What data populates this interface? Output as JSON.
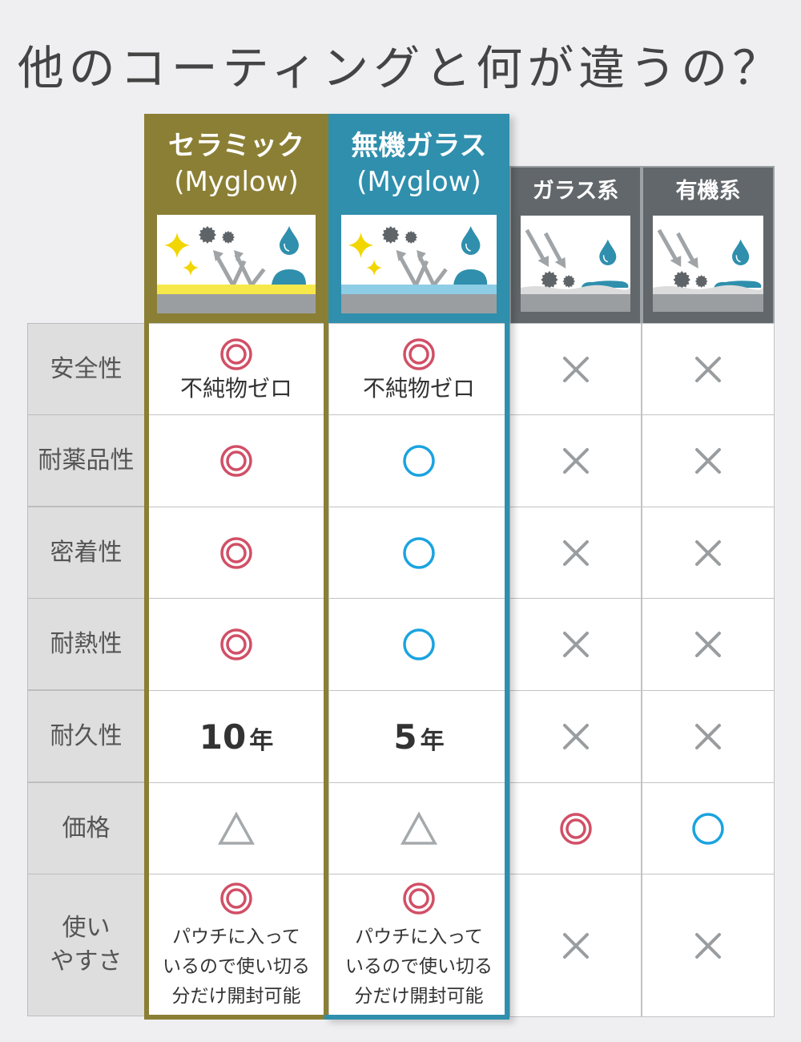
{
  "title": "他のコーティングと何が違うの？",
  "colors": {
    "olive": "#8b7f35",
    "teal": "#2f8fad",
    "gray_header": "#62676b",
    "double_circle": "#d14f66",
    "circle": "#1aa3e0",
    "cross": "#9a9d9f",
    "triangle": "#a5a9ac"
  },
  "columns": [
    {
      "name_line1": "セラミック",
      "name_line2": "(Myglow)",
      "illustration": "ceramic-coating-repel-illustration",
      "layer": "yellow"
    },
    {
      "name_line1": "無機ガラス",
      "name_line2": "(Myglow)",
      "illustration": "inorganic-glass-repel-illustration",
      "layer": "light-blue"
    },
    {
      "name_line1": "ガラス系",
      "illustration": "glass-type-absorb-illustration"
    },
    {
      "name_line1": "有機系",
      "illustration": "organic-type-absorb-illustration"
    }
  ],
  "rows": [
    {
      "label": "安全性",
      "cells": [
        {
          "mark": "double-circle",
          "note": "不純物ゼロ"
        },
        {
          "mark": "double-circle",
          "note": "不純物ゼロ"
        },
        {
          "mark": "cross"
        },
        {
          "mark": "cross"
        }
      ]
    },
    {
      "label": "耐薬品性",
      "cells": [
        {
          "mark": "double-circle"
        },
        {
          "mark": "circle"
        },
        {
          "mark": "cross"
        },
        {
          "mark": "cross"
        }
      ]
    },
    {
      "label": "密着性",
      "cells": [
        {
          "mark": "double-circle"
        },
        {
          "mark": "circle"
        },
        {
          "mark": "cross"
        },
        {
          "mark": "cross"
        }
      ]
    },
    {
      "label": "耐熱性",
      "cells": [
        {
          "mark": "double-circle"
        },
        {
          "mark": "circle"
        },
        {
          "mark": "cross"
        },
        {
          "mark": "cross"
        }
      ]
    },
    {
      "label": "耐久性",
      "cells": [
        {
          "value": "10",
          "unit": "年"
        },
        {
          "value": "5",
          "unit": "年"
        },
        {
          "mark": "cross"
        },
        {
          "mark": "cross"
        }
      ]
    },
    {
      "label": "価格",
      "cells": [
        {
          "mark": "triangle"
        },
        {
          "mark": "triangle"
        },
        {
          "mark": "double-circle"
        },
        {
          "mark": "circle"
        }
      ]
    },
    {
      "label_line1": "使い",
      "label_line2": "やすさ",
      "cells": [
        {
          "mark": "double-circle",
          "note_lines": [
            "パウチに入って",
            "いるので使い切る",
            "分だけ開封可能"
          ]
        },
        {
          "mark": "double-circle",
          "note_lines": [
            "パウチに入って",
            "いるので使い切る",
            "分だけ開封可能"
          ]
        },
        {
          "mark": "cross"
        },
        {
          "mark": "cross"
        }
      ]
    }
  ]
}
